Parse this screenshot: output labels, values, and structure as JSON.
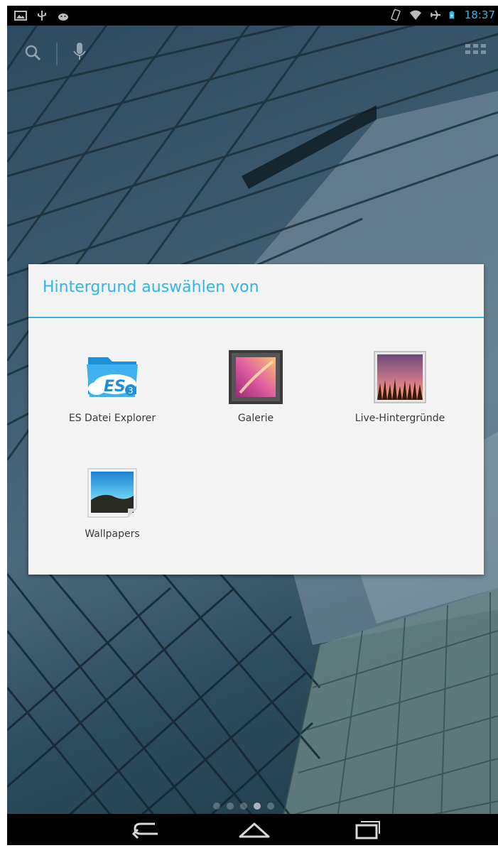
{
  "status_bar": {
    "time": "18:37",
    "left_icons": [
      "image-icon",
      "usb-icon",
      "android-icon"
    ],
    "right_icons": [
      "vibrate-icon",
      "wifi-icon",
      "airplane-icon",
      "battery-charging-icon"
    ]
  },
  "home": {
    "search_icon": "search-icon",
    "mic_icon": "microphone-icon",
    "apps_icon": "apps-grid-icon"
  },
  "dialog": {
    "title": "Hintergrund auswählen von",
    "accent_color": "#33b5e5",
    "apps": [
      {
        "label": "ES Datei Explorer",
        "icon": "es-file-explorer-icon"
      },
      {
        "label": "Galerie",
        "icon": "gallery-icon"
      },
      {
        "label": "Live-Hintergründe",
        "icon": "live-wallpapers-icon"
      },
      {
        "label": "Wallpapers",
        "icon": "wallpapers-icon"
      }
    ]
  },
  "page_indicator": {
    "count": 5,
    "active_index": 3
  },
  "nav_bar": {
    "back": "back-icon",
    "home": "home-icon",
    "recents": "recent-apps-icon"
  }
}
